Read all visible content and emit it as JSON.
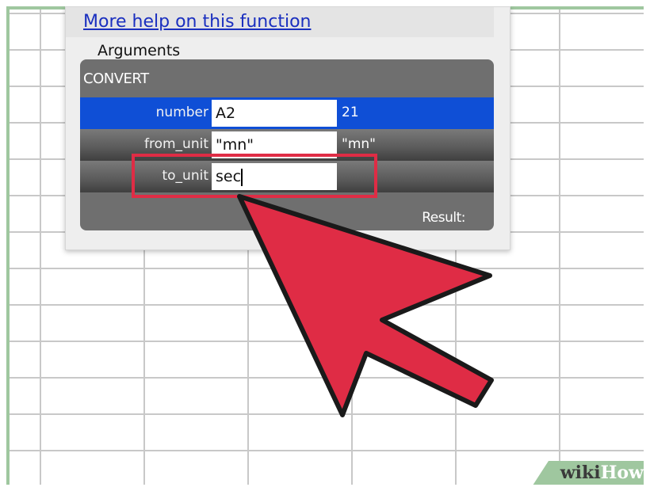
{
  "dialog": {
    "help_link": "More help on this function",
    "arguments_label": "Arguments",
    "function_name": "CONVERT",
    "rows": [
      {
        "label": "number",
        "input": "A2",
        "value": "21"
      },
      {
        "label": "from_unit",
        "input": "\"mn\"",
        "value": "\"mn\""
      },
      {
        "label": "to_unit",
        "input": "sec",
        "value": ""
      }
    ],
    "result_label": "Result:"
  },
  "watermark": {
    "part1": "wiki",
    "part2": "How"
  },
  "colors": {
    "selected_row": "#0f4fd6",
    "highlight": "#df2c45",
    "pointer": "#df2c45",
    "link": "#1a2fbf",
    "grid_accent": "#9fc79f"
  },
  "icons": {
    "pointer": "arrow-cursor-icon"
  }
}
